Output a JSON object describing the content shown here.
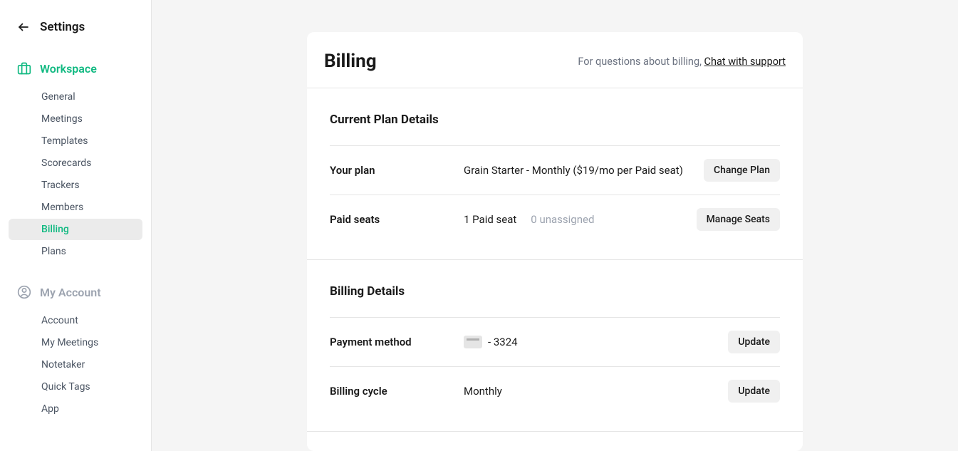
{
  "sidebar": {
    "title": "Settings",
    "workspace": {
      "label": "Workspace",
      "items": [
        {
          "label": "General"
        },
        {
          "label": "Meetings"
        },
        {
          "label": "Templates"
        },
        {
          "label": "Scorecards"
        },
        {
          "label": "Trackers"
        },
        {
          "label": "Members"
        },
        {
          "label": "Billing"
        },
        {
          "label": "Plans"
        }
      ]
    },
    "account": {
      "label": "My Account",
      "items": [
        {
          "label": "Account"
        },
        {
          "label": "My Meetings"
        },
        {
          "label": "Notetaker"
        },
        {
          "label": "Quick Tags"
        },
        {
          "label": "App"
        }
      ]
    }
  },
  "header": {
    "title": "Billing",
    "help_prefix": "For questions about billing, ",
    "help_link": "Chat with support"
  },
  "plan_section": {
    "title": "Current Plan Details",
    "plan_label": "Your plan",
    "plan_value": "Grain Starter - Monthly ($19/mo per Paid seat)",
    "plan_action": "Change Plan",
    "seats_label": "Paid seats",
    "seats_value": "1 Paid seat",
    "seats_unassigned": "0 unassigned",
    "seats_action": "Manage Seats"
  },
  "billing_section": {
    "title": "Billing Details",
    "payment_label": "Payment method",
    "payment_value": "- 3324",
    "payment_action": "Update",
    "cycle_label": "Billing cycle",
    "cycle_value": "Monthly",
    "cycle_action": "Update"
  }
}
